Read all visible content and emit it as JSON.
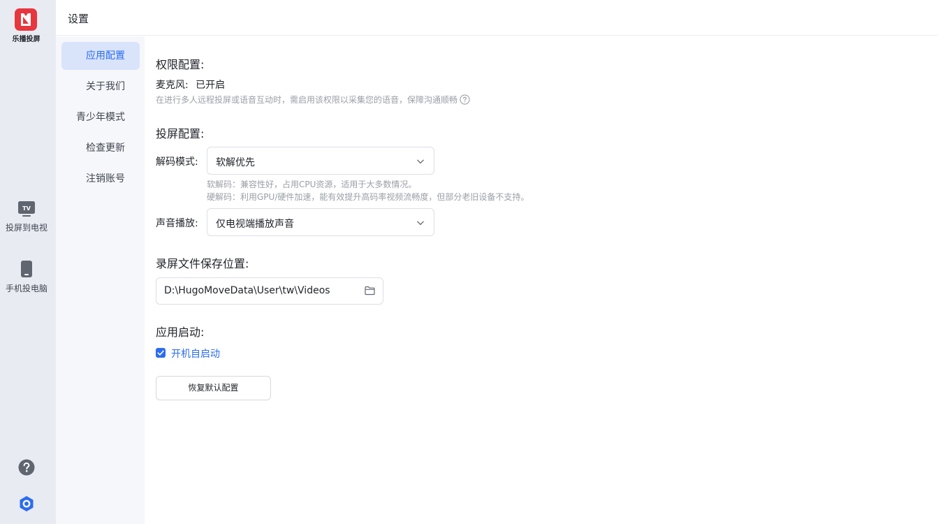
{
  "app": {
    "name": "乐播投屏",
    "brand_color": "#e8363f",
    "accent_color": "#2b6cf0"
  },
  "rail": {
    "items": [
      {
        "label": "投屏到电视",
        "icon": "tv-icon",
        "icon_text": "TV"
      },
      {
        "label": "手机投电脑",
        "icon": "phone-icon"
      }
    ],
    "help_icon": "help-icon",
    "settings_icon": "gear-icon"
  },
  "header": {
    "title": "设置"
  },
  "nav": {
    "items": [
      {
        "label": "应用配置",
        "active": true
      },
      {
        "label": "关于我们",
        "active": false
      },
      {
        "label": "青少年模式",
        "active": false
      },
      {
        "label": "检查更新",
        "active": false
      },
      {
        "label": "注销账号",
        "active": false
      }
    ]
  },
  "permissions": {
    "title": "权限配置:",
    "mic_label": "麦克风:",
    "mic_status": "已开启",
    "mic_hint": "在进行多人远程投屏或语音互动时，需启用该权限以采集您的语音，保障沟通顺畅"
  },
  "cast": {
    "title": "投屏配置:",
    "decode_label": "解码模式:",
    "decode_value": "软解优先",
    "decode_hint_1": "软解码：兼容性好，占用CPU资源，适用于大多数情况。",
    "decode_hint_2": "硬解码：利用GPU/硬件加速，能有效提升高码率视频流畅度，但部分老旧设备不支持。",
    "audio_label": "声音播放:",
    "audio_value": "仅电视端播放声音"
  },
  "recording": {
    "title": "录屏文件保存位置:",
    "path": "D:\\HugoMoveData\\User\\tw\\Videos"
  },
  "startup": {
    "title": "应用启动:",
    "autostart_label": "开机自启动",
    "autostart_checked": true
  },
  "reset_label": "恢复默认配置"
}
